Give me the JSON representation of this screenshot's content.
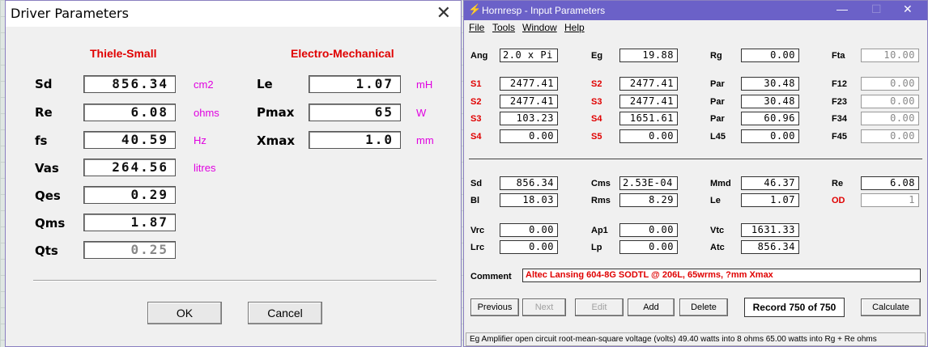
{
  "driver_window": {
    "title": "Driver Parameters",
    "header_ts": "Thiele-Small",
    "header_em": "Electro-Mechanical",
    "ts_params": [
      {
        "label": "Sd",
        "value": "856.34",
        "unit": "cm2"
      },
      {
        "label": "Re",
        "value": "6.08",
        "unit": "ohms"
      },
      {
        "label": "fs",
        "value": "40.59",
        "unit": "Hz"
      },
      {
        "label": "Vas",
        "value": "264.56",
        "unit": "litres"
      },
      {
        "label": "Qes",
        "value": "0.29",
        "unit": ""
      },
      {
        "label": "Qms",
        "value": "1.87",
        "unit": ""
      },
      {
        "label": "Qts",
        "value": "0.25",
        "unit": ""
      }
    ],
    "em_params": [
      {
        "label": "Le",
        "value": "1.07",
        "unit": "mH"
      },
      {
        "label": "Pmax",
        "value": "65",
        "unit": "W"
      },
      {
        "label": "Xmax",
        "value": "1.0",
        "unit": "mm"
      }
    ],
    "ok_label": "OK",
    "cancel_label": "Cancel",
    "close_glyph": "✕"
  },
  "hornresp": {
    "title": "Hornresp - Input Parameters",
    "menu": [
      "File",
      "Tools",
      "Window",
      "Help"
    ],
    "row_ang": {
      "l1": "Ang",
      "v1": "2.0 x Pi",
      "l2": "Eg",
      "v2": "19.88",
      "l3": "Rg",
      "v3": "0.00",
      "l4": "Fta",
      "v4": "10.00"
    },
    "horn_rows": [
      {
        "l1": "S1",
        "v1": "2477.41",
        "l2": "S2",
        "v2": "2477.41",
        "l3": "Par",
        "v3": "30.48",
        "l4": "F12",
        "v4": "0.00"
      },
      {
        "l1": "S2",
        "v1": "2477.41",
        "l2": "S3",
        "v2": "2477.41",
        "l3": "Par",
        "v3": "30.48",
        "l4": "F23",
        "v4": "0.00"
      },
      {
        "l1": "S3",
        "v1": "103.23",
        "l2": "S4",
        "v2": "1651.61",
        "l3": "Par",
        "v3": "60.96",
        "l4": "F34",
        "v4": "0.00"
      },
      {
        "l1": "S4",
        "v1": "0.00",
        "l2": "S5",
        "v2": "0.00",
        "l3": "L45",
        "v3": "0.00",
        "l4": "F45",
        "v4": "0.00"
      }
    ],
    "driver_rows": [
      {
        "l1": "Sd",
        "v1": "856.34",
        "l2": "Cms",
        "v2": "2.53E-04",
        "l3": "Mmd",
        "v3": "46.37",
        "l4": "Re",
        "v4": "6.08"
      },
      {
        "l1": "Bl",
        "v1": "18.03",
        "l2": "Rms",
        "v2": "8.29",
        "l3": "Le",
        "v3": "1.07",
        "l4": "OD",
        "v4": "1"
      }
    ],
    "chamber_rows": [
      {
        "l1": "Vrc",
        "v1": "0.00",
        "l2": "Ap1",
        "v2": "0.00",
        "l3": "Vtc",
        "v3": "1631.33"
      },
      {
        "l1": "Lrc",
        "v1": "0.00",
        "l2": "Lp",
        "v2": "0.00",
        "l3": "Atc",
        "v3": "856.34"
      }
    ],
    "comment_label": "Comment",
    "comment_value": "Altec Lansing 604-8G SODTL @ 206L, 65wrms, ?mm Xmax",
    "buttons": {
      "previous": "Previous",
      "next": "Next",
      "edit": "Edit",
      "add": "Add",
      "delete": "Delete",
      "calculate": "Calculate"
    },
    "record": "Record 750 of 750",
    "status": "Eg  Amplifier open circuit root-mean-square voltage  (volts)  49.40 watts into 8 ohms   65.00 watts into Rg + Re ohms"
  }
}
